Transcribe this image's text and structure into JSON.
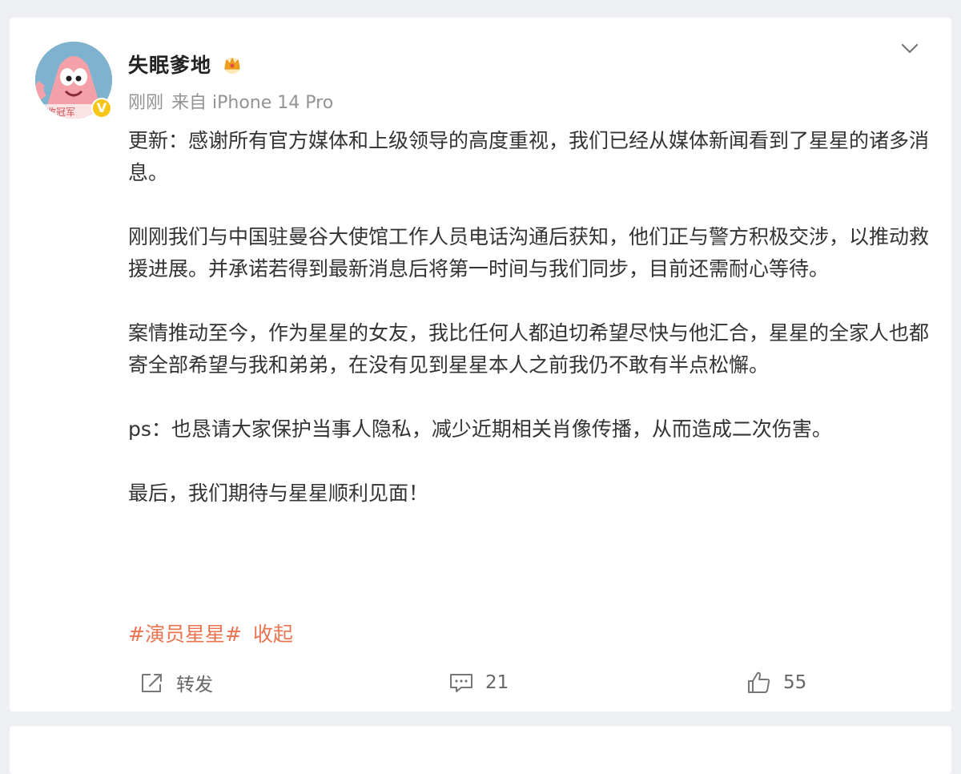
{
  "post": {
    "username": "失眠爹地",
    "avatar_badge_text": "收冠军",
    "meta": {
      "time": "刚刚",
      "source": "来自 iPhone 14 Pro"
    },
    "paragraphs": [
      "更新：感谢所有官方媒体和上级领导的高度重视，我们已经从媒体新闻看到了星星的诸多消息。",
      "刚刚我们与中国驻曼谷大使馆工作人员电话沟通后获知，他们正与警方积极交涉，以推动救援进展。并承诺若得到最新消息后将第一时间与我们同步，目前还需耐心等待。",
      "案情推动至今，作为星星的女友，我比任何人都迫切希望尽快与他汇合，星星的全家人也都寄全部希望与我和弟弟，在没有见到星星本人之前我仍不敢有半点松懈。",
      "ps：也恳请大家保护当事人隐私，减少近期相关肖像传播，从而造成二次伤害。",
      "最后，我们期待与星星顺利见面！"
    ],
    "hashtag": "#演员星星#",
    "collapse_label": "收起"
  },
  "actions": {
    "repost_label": "转发",
    "comment_count": "21",
    "like_count": "55"
  },
  "colors": {
    "accent": "#eb7350",
    "verified": "#f5c518",
    "meta_text": "#939393",
    "background": "#eeeff2"
  },
  "icons": {
    "user_badge": "crown-icon",
    "menu": "chevron-down-icon",
    "repost": "repost-icon",
    "comment": "comment-icon",
    "like": "thumbs-up-icon"
  }
}
